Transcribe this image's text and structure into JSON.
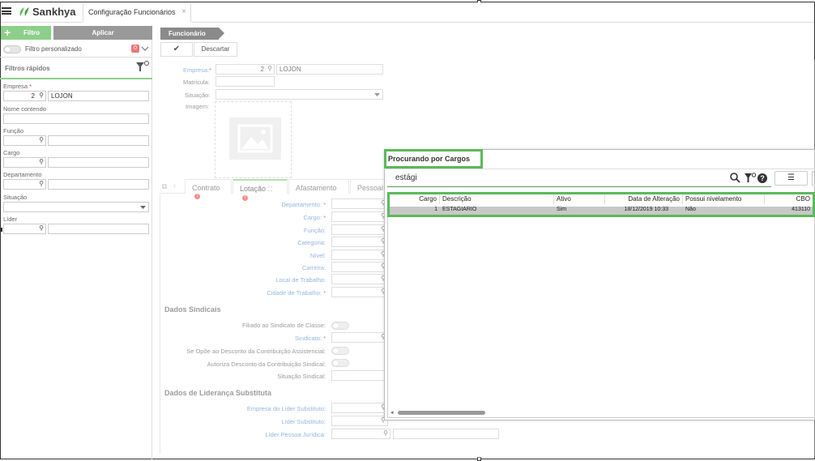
{
  "app": {
    "logo": "Sankhya",
    "tab_title": "Configuração Funcionários",
    "tab_close": "×"
  },
  "left": {
    "filtro_btn": "Filtro",
    "filtro_plus": "+",
    "aplicar_btn": "Aplicar",
    "filtro_personalizado": "Filtro personalizado",
    "filtro_count": "0",
    "filtros_rapidos": "Filtros rápidos",
    "empresa_label": "Empresa",
    "empresa_code": "2",
    "empresa_name": "LOJON",
    "nome_label": "Nome contendo",
    "funcao_label": "Função",
    "cargo_label": "Cargo",
    "departamento_label": "Departamento",
    "situacao_label": "Situação",
    "lider_label": "Líder"
  },
  "form": {
    "breadcrumb": "Funcionário",
    "discard_btn": "Descartar",
    "empresa_label": "Empresa:",
    "empresa_code": "2",
    "empresa_name": "LOJON",
    "matricula_label": "Matrícula:",
    "situacao_label": "Situação:",
    "imagem_label": "Imagem:",
    "tabs": [
      {
        "label": "Contrato"
      },
      {
        "label": "Lotação"
      },
      {
        "label": "Afastamento"
      },
      {
        "label": "Pessoal"
      }
    ],
    "lotacao_fields": [
      {
        "label": "Departamento:",
        "required": true
      },
      {
        "label": "Cargo:",
        "required": true
      },
      {
        "label": "Função:",
        "required": false
      },
      {
        "label": "Categoria:",
        "required": false
      },
      {
        "label": "Nível:",
        "required": false
      },
      {
        "label": "Carreira:",
        "required": false
      },
      {
        "label": "Local de Trabalho:",
        "required": false
      },
      {
        "label": "Cidade de Trabalho:",
        "required": true
      }
    ],
    "dados_sindicais_title": "Dados Sindicais",
    "filiado_label": "Filiado ao Sindicato de Classe:",
    "sindicato_label": "Sindicato:",
    "opoe_label": "Se Opõe ao Desconto da Contribuição Assistencial:",
    "autoriza_label": "Autoriza Desconto da Contribuição Sindical:",
    "situacao_sindical_label": "Situação Sindical:",
    "dados_lideranca_title": "Dados de Liderança Substituta",
    "empresa_lider_label": "Empresa do Líder Substituto:",
    "lider_substituto_label": "Líder Substituto:",
    "lider_pj_label": "Líder Pessoa Jurídica:"
  },
  "modal": {
    "title": "Procurando por Cargos",
    "search_value": "estági",
    "columns": [
      "Cargo",
      "Descrição",
      "Ativo",
      "Data de Alteração",
      "Possui nivelamento",
      "CBO"
    ],
    "rows": [
      {
        "cargo": "1",
        "descricao": "ESTAGIARIO",
        "ativo": "Sim",
        "data": "18/12/2019 10:33",
        "nivelamento": "Não",
        "cbo": "413110"
      }
    ]
  },
  "colors": {
    "brand_green": "#8ccf8a",
    "highlight_green": "#5cb85c",
    "label_blue": "#5a8fd0",
    "required_red": "#d33"
  }
}
